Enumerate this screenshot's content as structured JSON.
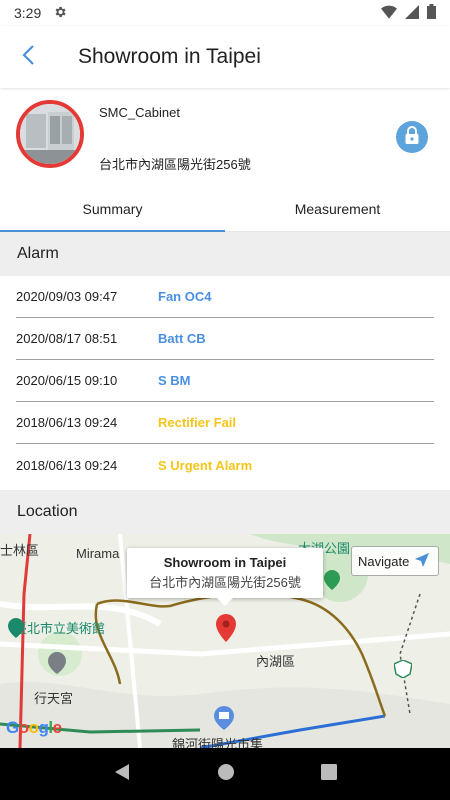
{
  "status_bar": {
    "time": "3:29",
    "settings_icon": "gear-icon",
    "wifi_icon": "wifi-icon",
    "signal_icon": "signal-icon",
    "battery_icon": "battery-icon"
  },
  "app_bar": {
    "title": "Showroom in Taipei",
    "back_icon": "chevron-left-icon"
  },
  "site": {
    "name": "SMC_Cabinet",
    "address": "台北市內湖區陽光街256號",
    "lock_icon": "lock-icon",
    "avatar_border_color": "#e53935"
  },
  "tabs": [
    {
      "label": "Summary",
      "active": true
    },
    {
      "label": "Measurement",
      "active": false
    }
  ],
  "alarm_section": {
    "title": "Alarm"
  },
  "alarms": [
    {
      "time": "2020/09/03 09:47",
      "name": "Fan OC4",
      "color": "#4a90e2"
    },
    {
      "time": "2020/08/17 08:51",
      "name": "Batt CB",
      "color": "#4a90e2"
    },
    {
      "time": "2020/06/15 09:10",
      "name": "S BM",
      "color": "#4a90e2"
    },
    {
      "time": "2018/06/13 09:24",
      "name": "Rectifier Fail",
      "color": "#f5c518"
    },
    {
      "time": "2018/06/13 09:24",
      "name": "S Urgent Alarm",
      "color": "#f5c518"
    }
  ],
  "location_section": {
    "title": "Location"
  },
  "map": {
    "info_title": "Showroom in Taipei",
    "info_address": "台北市內湖區陽光街256號",
    "navigate_label": "Navigate",
    "labels": {
      "shilin": "士林區",
      "mirama": "Mirama",
      "dahu_park": "大湖公園",
      "museum": "臺北市立美術館",
      "neihu": "內湖區",
      "xingtian": "行天宮",
      "bottom_road": "錦河街陽光市集"
    },
    "google": "Google",
    "pin_color": "#e53935"
  },
  "nav_bar": {
    "back_icon": "triangle-back-icon",
    "home_icon": "circle-home-icon",
    "recents_icon": "square-recents-icon"
  }
}
